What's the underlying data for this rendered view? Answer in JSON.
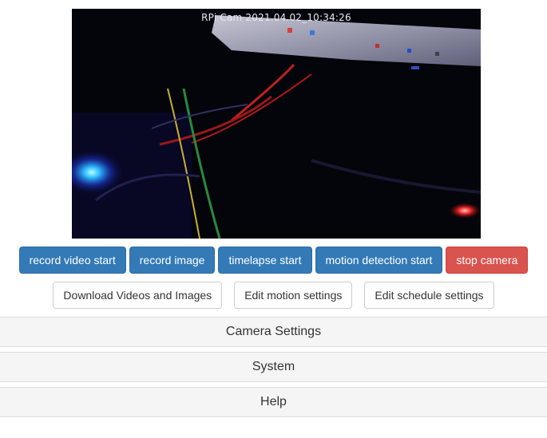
{
  "camera": {
    "overlay": "RPi Cam  2021.04.02_10:34:26"
  },
  "buttons": {
    "record_video": "record video start",
    "record_image": "record image",
    "timelapse": "timelapse start",
    "motion_detection": "motion detection start",
    "stop_camera": "stop camera"
  },
  "links": {
    "download": "Download Videos and Images",
    "edit_motion": "Edit motion settings",
    "edit_schedule": "Edit schedule settings"
  },
  "panels": {
    "camera_settings": "Camera Settings",
    "system": "System",
    "help": "Help"
  },
  "colors": {
    "primary": "#337ab7",
    "danger": "#d9534f",
    "panel_bg": "#f5f5f5"
  }
}
